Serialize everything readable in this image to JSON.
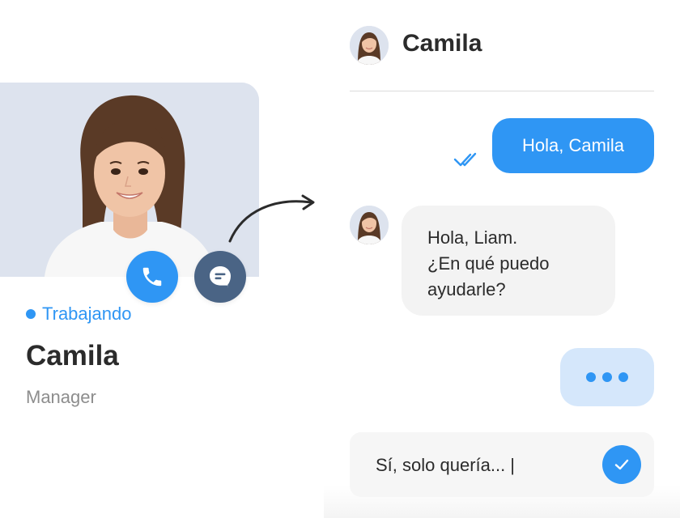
{
  "profile": {
    "status": "Trabajando",
    "name": "Camila",
    "role": "Manager"
  },
  "chat": {
    "contact_name": "Camila",
    "outgoing_message": "Hola, Camila",
    "incoming_message_lines": [
      "Hola, Liam.",
      "¿En qué puedo",
      "ayudarle?"
    ],
    "composer_text": "Sí, solo quería... |"
  },
  "icons": {
    "call": "phone-icon",
    "chat": "chat-bubble-icon",
    "read": "double-check-icon",
    "send": "checkmark-icon",
    "connector": "curved-arrow-icon"
  },
  "colors": {
    "accent": "#2f96f4",
    "chat_button": "#4a6485",
    "photo_background": "#dde3ee",
    "typing_bubble": "#d5e7fb",
    "incoming_bubble": "#f3f3f3"
  }
}
